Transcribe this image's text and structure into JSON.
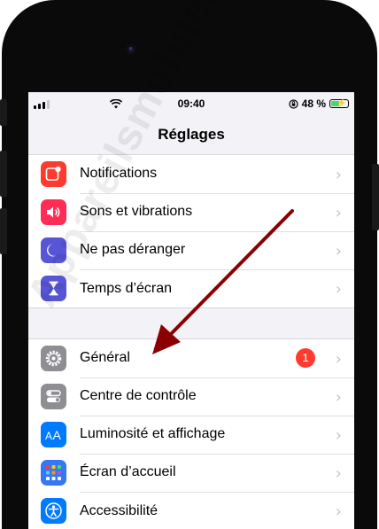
{
  "statusbar": {
    "time": "09:40",
    "battery_percent": "48 %",
    "battery_level": 0.48,
    "signal_bars": 3
  },
  "header": {
    "title": "Réglages"
  },
  "groups": [
    {
      "items": [
        {
          "label": "Notifications",
          "icon": "notifications-icon",
          "color": "#ff3b30"
        },
        {
          "label": "Sons et vibrations",
          "icon": "speaker-icon",
          "color": "#ff2d55"
        },
        {
          "label": "Ne pas déranger",
          "icon": "moon-icon",
          "color": "#5856d6"
        },
        {
          "label": "Temps d’écran",
          "icon": "hourglass-icon",
          "color": "#5856d6"
        }
      ]
    },
    {
      "items": [
        {
          "label": "Général",
          "icon": "gear-icon",
          "color": "#8e8e93",
          "badge": "1"
        },
        {
          "label": "Centre de contrôle",
          "icon": "toggles-icon",
          "color": "#8e8e93"
        },
        {
          "label": "Luminosité et affichage",
          "icon": "text-size-icon",
          "color": "#007aff"
        },
        {
          "label": "Écran d’accueil",
          "icon": "home-grid-icon",
          "color": "#3478f6"
        },
        {
          "label": "Accessibilité",
          "icon": "accessibility-icon",
          "color": "#007aff"
        }
      ]
    }
  ],
  "watermark": "Appareilsmobiles.fr",
  "annotation": {
    "arrow_color": "#8b0000"
  }
}
